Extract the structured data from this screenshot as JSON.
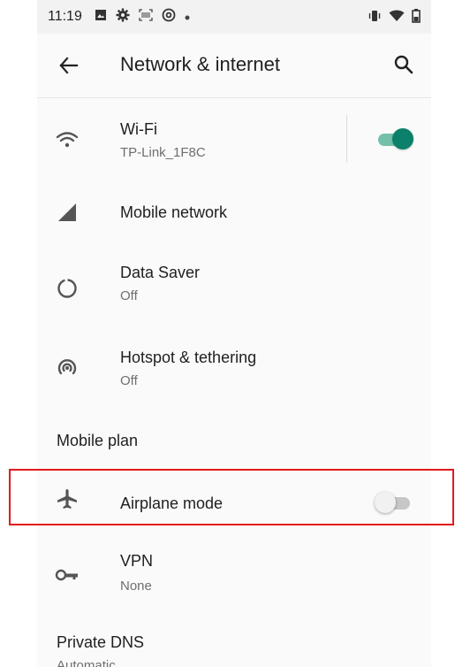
{
  "status_bar": {
    "time": "11:19",
    "left_icons": [
      "image-icon",
      "gear-icon",
      "scan-icon",
      "at-icon",
      "dot-icon"
    ],
    "right_icons": [
      "vibrate-icon",
      "wifi-icon",
      "battery-icon"
    ]
  },
  "toolbar": {
    "title": "Network & internet",
    "back_icon": "arrow-left-icon",
    "search_icon": "search-icon"
  },
  "items": {
    "wifi": {
      "title": "Wi-Fi",
      "subtitle": "TP-Link_1F8C",
      "icon": "wifi-icon",
      "toggle_on": true
    },
    "mobile_network": {
      "title": "Mobile network",
      "icon": "signal-icon"
    },
    "data_saver": {
      "title": "Data Saver",
      "subtitle": "Off",
      "icon": "data-saver-icon"
    },
    "hotspot": {
      "title": "Hotspot & tethering",
      "subtitle": "Off",
      "icon": "hotspot-icon"
    },
    "mobile_plan": {
      "title": "Mobile plan"
    },
    "airplane": {
      "title": "Airplane mode",
      "icon": "airplane-icon",
      "toggle_on": false
    },
    "vpn": {
      "title": "VPN",
      "subtitle": "None",
      "icon": "vpn-key-icon"
    },
    "private_dns": {
      "title": "Private DNS",
      "subtitle": "Automatic"
    }
  },
  "colors": {
    "accent": "#0b806a",
    "accent_track": "#74c0ab",
    "highlight": "#e3191b"
  }
}
